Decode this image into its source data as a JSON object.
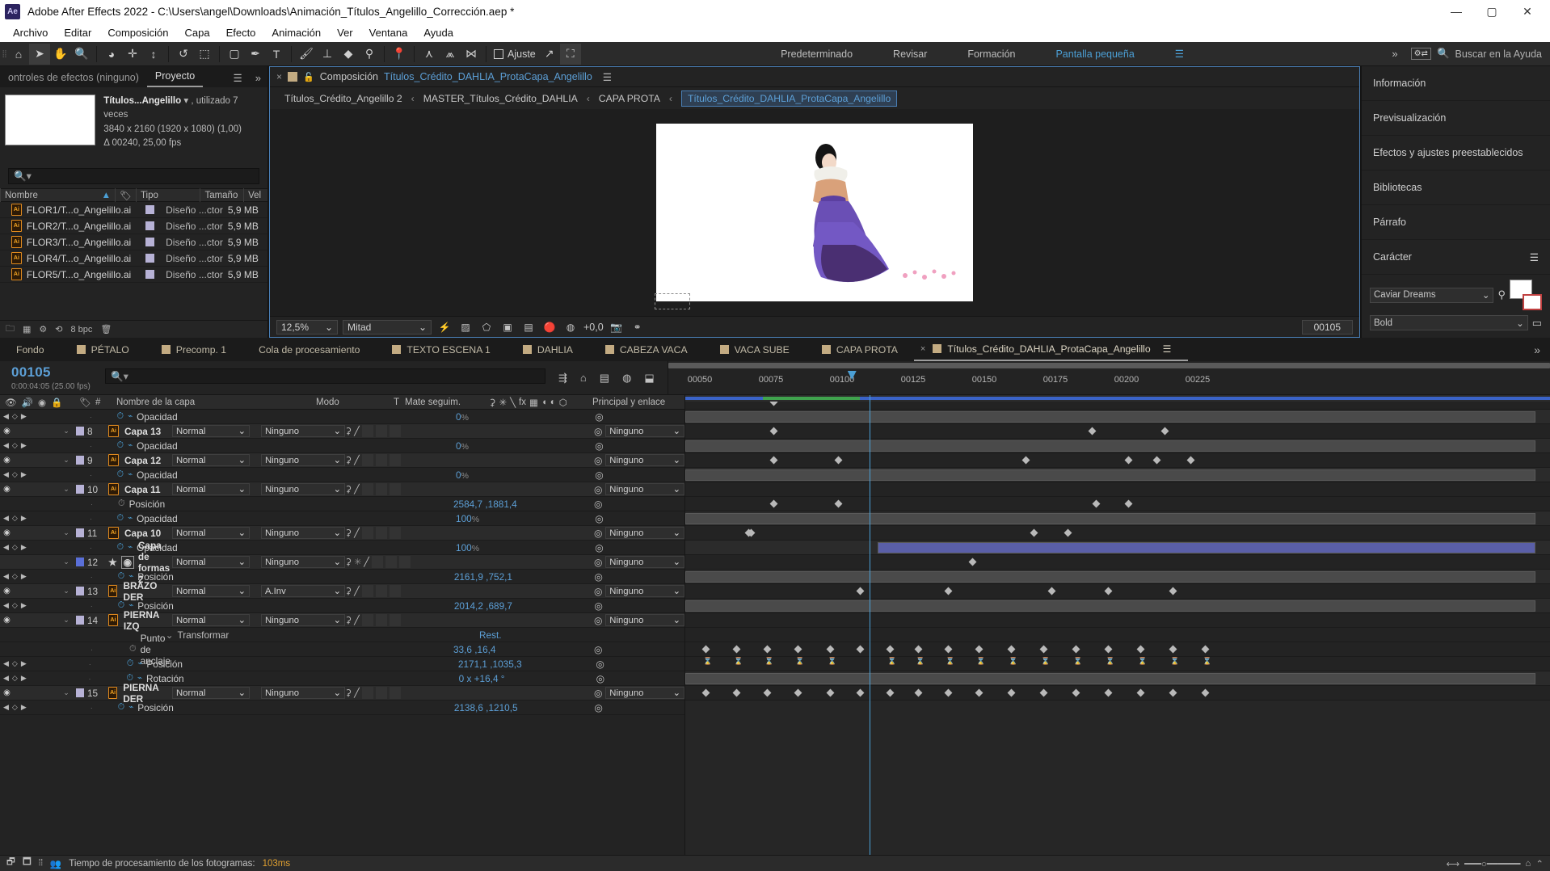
{
  "window": {
    "app_badge": "Ae",
    "title": "Adobe After Effects 2022 - C:\\Users\\angel\\Downloads\\Animación_Títulos_Angelillo_Corrección.aep *",
    "minimize": "—",
    "maximize": "▢",
    "close": "✕"
  },
  "menu": [
    "Archivo",
    "Editar",
    "Composición",
    "Capa",
    "Efecto",
    "Animación",
    "Ver",
    "Ventana",
    "Ayuda"
  ],
  "toolbar": {
    "snap_label": "Ajuste",
    "workspaces": [
      "Predeterminado",
      "Revisar",
      "Formación"
    ],
    "current_workspace": "Pantalla pequeña",
    "ws_menu": "☰",
    "overflow": "»",
    "search_placeholder": "Buscar en la Ayuda",
    "accent": "#4b9fd5"
  },
  "project_panel": {
    "tabs": [
      {
        "label": "ontroles de efectos (ninguno)",
        "active": false
      },
      {
        "label": "Proyecto",
        "active": true
      }
    ],
    "menu_icon": "☰",
    "overflow": "»",
    "item_name": "Títulos...Angelillo",
    "item_usage": ", utilizado 7 veces",
    "item_dims": "3840 x 2160  (1920 x 1080) (1,00)",
    "item_duration": "Δ 00240, 25,00 fps",
    "search_placeholder": "",
    "columns": [
      "Nombre",
      "Tipo",
      "Tamaño",
      "Vel"
    ],
    "files": [
      {
        "name": "FLOR1/T...o_Angelillo.ai",
        "type": "Diseño ...ctor",
        "size": "5,9 MB"
      },
      {
        "name": "FLOR2/T...o_Angelillo.ai",
        "type": "Diseño ...ctor",
        "size": "5,9 MB"
      },
      {
        "name": "FLOR3/T...o_Angelillo.ai",
        "type": "Diseño ...ctor",
        "size": "5,9 MB"
      },
      {
        "name": "FLOR4/T...o_Angelillo.ai",
        "type": "Diseño ...ctor",
        "size": "5,9 MB"
      },
      {
        "name": "FLOR5/T...o_Angelillo.ai",
        "type": "Diseño ...ctor",
        "size": "5,9 MB"
      }
    ],
    "bit_depth": "8 bpc"
  },
  "composition": {
    "tab_close": "×",
    "tab_label": "Composición",
    "tab_name": "Títulos_Crédito_DAHLIA_ProtaCapa_Angelillo",
    "menu_icon": "☰",
    "breadcrumb": [
      {
        "label": "Títulos_Crédito_Angelillo 2",
        "current": false
      },
      {
        "label": "MASTER_Títulos_Crédito_DAHLIA",
        "current": false
      },
      {
        "label": "CAPA PROTA",
        "current": false
      },
      {
        "label": "Títulos_Crédito_DAHLIA_ProtaCapa_Angelillo",
        "current": true
      }
    ],
    "breadcrumb_sep": "‹",
    "zoom": "12,5%",
    "resolution": "Mitad",
    "exposure": "+0,0",
    "timecode": "00105"
  },
  "right_panel": {
    "sections": [
      "Información",
      "Previsualización",
      "Efectos y ajustes preestablecidos",
      "Bibliotecas",
      "Párrafo"
    ],
    "character": {
      "title": "Carácter",
      "menu": "☰",
      "font_family": "Caviar Dreams",
      "font_style": "Bold"
    }
  },
  "timeline": {
    "tabs": [
      {
        "label": "Fondo",
        "swatch": false,
        "active": false
      },
      {
        "label": "PÉTALO",
        "swatch": true,
        "active": false
      },
      {
        "label": "Precomp. 1",
        "swatch": true,
        "active": false
      },
      {
        "label": "Cola de procesamiento",
        "swatch": false,
        "active": false
      },
      {
        "label": "TEXTO ESCENA 1",
        "swatch": true,
        "active": false
      },
      {
        "label": "DAHLIA",
        "swatch": true,
        "active": false
      },
      {
        "label": "CABEZA VACA",
        "swatch": true,
        "active": false
      },
      {
        "label": "VACA SUBE",
        "swatch": true,
        "active": false
      },
      {
        "label": "CAPA PROTA",
        "swatch": true,
        "active": false
      },
      {
        "label": "Títulos_Crédito_DAHLIA_ProtaCapa_Angelillo",
        "swatch": true,
        "active": true
      }
    ],
    "tabs_menu": "☰",
    "overflow": "»",
    "current_time": "00105",
    "current_time_sub": "0:00:04:05 (25.00 fps)",
    "search_placeholder": "",
    "ruler_ticks": [
      "00050",
      "00075",
      "00100",
      "00125",
      "00150",
      "00175",
      "00200",
      "00225"
    ],
    "columns": {
      "layer_name": "Nombre de la capa",
      "mode": "Modo",
      "t": "T",
      "matte": "Mate seguim.",
      "parent": "Principal y enlace"
    },
    "rows": [
      {
        "kind": "prop",
        "indent": 1,
        "kfnav": true,
        "stopwatch": "on",
        "graph": true,
        "name": "Opacidad",
        "value": "0",
        "unit": "%"
      },
      {
        "kind": "layer",
        "num": "8",
        "name": "Capa 13",
        "mode": "Normal",
        "matte": "Ninguno",
        "parent": "Ninguno",
        "label": "lav"
      },
      {
        "kind": "prop",
        "indent": 1,
        "kfnav": true,
        "stopwatch": "on",
        "graph": true,
        "name": "Opacidad",
        "value": "0",
        "unit": "%"
      },
      {
        "kind": "layer",
        "num": "9",
        "name": "Capa 12",
        "mode": "Normal",
        "matte": "Ninguno",
        "parent": "Ninguno",
        "label": "lav"
      },
      {
        "kind": "prop",
        "indent": 1,
        "kfnav": true,
        "stopwatch": "on",
        "graph": true,
        "name": "Opacidad",
        "value": "0",
        "unit": "%"
      },
      {
        "kind": "layer",
        "num": "10",
        "name": "Capa 11",
        "mode": "Normal",
        "matte": "Ninguno",
        "parent": "Ninguno",
        "label": "lav"
      },
      {
        "kind": "prop",
        "indent": 1,
        "kfnav": false,
        "stopwatch": "off",
        "graph": false,
        "name": "Posición",
        "value": "2584,7 ,1881,4",
        "unit": ""
      },
      {
        "kind": "prop",
        "indent": 1,
        "kfnav": true,
        "stopwatch": "on",
        "graph": true,
        "name": "Opacidad",
        "value": "100",
        "unit": "%"
      },
      {
        "kind": "layer",
        "num": "11",
        "name": "Capa 10",
        "mode": "Normal",
        "matte": "Ninguno",
        "parent": "Ninguno",
        "label": "lav"
      },
      {
        "kind": "prop",
        "indent": 1,
        "kfnav": true,
        "stopwatch": "on",
        "graph": true,
        "name": "Opacidad",
        "value": "100",
        "unit": "%"
      },
      {
        "kind": "layer",
        "num": "12",
        "name": "Capa de formas 2",
        "mode": "Normal",
        "matte": "Ninguno",
        "parent": "Ninguno",
        "label": "blue",
        "shape": true
      },
      {
        "kind": "prop",
        "indent": 1,
        "kfnav": true,
        "stopwatch": "on",
        "graph": true,
        "name": "Posición",
        "value": "2161,9 ,752,1",
        "unit": ""
      },
      {
        "kind": "layer",
        "num": "13",
        "name": "BRAZO DER",
        "mode": "Normal",
        "matte": "A.Inv",
        "parent": "Ninguno",
        "label": "lav"
      },
      {
        "kind": "prop",
        "indent": 1,
        "kfnav": true,
        "stopwatch": "on",
        "graph": true,
        "name": "Posición",
        "value": "2014,2 ,689,7",
        "unit": ""
      },
      {
        "kind": "layer",
        "num": "14",
        "name": "PIERNA IZQ",
        "mode": "Normal",
        "matte": "Ninguno",
        "parent": "Ninguno",
        "label": "lav"
      },
      {
        "kind": "group",
        "indent": 1,
        "name": "Transformar",
        "value": "Rest."
      },
      {
        "kind": "prop",
        "indent": 2,
        "kfnav": false,
        "stopwatch": "off",
        "graph": false,
        "name": "Punto de anclaje",
        "value": "33,6 ,16,4",
        "unit": ""
      },
      {
        "kind": "prop",
        "indent": 2,
        "kfnav": true,
        "stopwatch": "on",
        "graph": true,
        "name": "Posición",
        "value": "2171,1 ,1035,3",
        "unit": ""
      },
      {
        "kind": "prop",
        "indent": 2,
        "kfnav": true,
        "stopwatch": "on",
        "graph": true,
        "name": "Rotación",
        "value": "0 x +16,4 °",
        "unit": ""
      },
      {
        "kind": "layer",
        "num": "15",
        "name": "PIERNA DER",
        "mode": "Normal",
        "matte": "Ninguno",
        "parent": "Ninguno",
        "label": "lav"
      },
      {
        "kind": "prop",
        "indent": 1,
        "kfnav": true,
        "stopwatch": "on",
        "graph": true,
        "name": "Posición",
        "value": "2138,6 ,1210,5",
        "unit": ""
      }
    ],
    "status": "Tiempo de procesamiento de los fotogramas:",
    "status_value": "103ms"
  }
}
